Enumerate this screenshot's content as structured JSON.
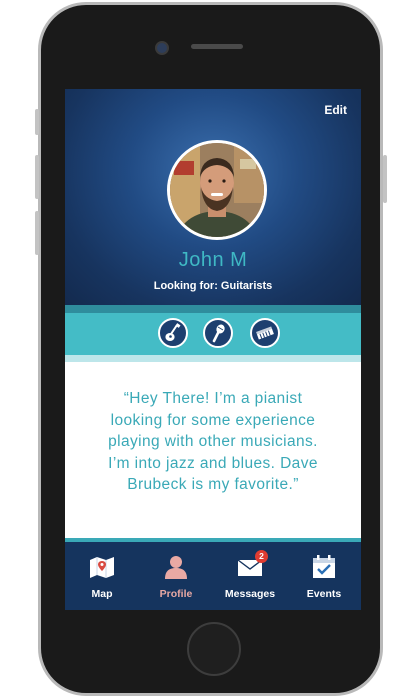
{
  "header": {
    "edit_label": "Edit",
    "name": "John M",
    "looking_for": "Looking for: Guitarists"
  },
  "instruments": [
    {
      "icon": "guitar-icon"
    },
    {
      "icon": "microphone-icon"
    },
    {
      "icon": "keyboard-icon"
    }
  ],
  "bio": {
    "lines": [
      "“Hey There! I’m a pianist",
      "looking for some experience",
      "playing with other musicians.",
      "I’m into jazz and blues. Dave",
      "Brubeck is my favorite.”"
    ]
  },
  "tabbar": {
    "tabs": [
      {
        "label": "Map",
        "icon": "map-icon",
        "active": false
      },
      {
        "label": "Profile",
        "icon": "profile-icon",
        "active": true
      },
      {
        "label": "Messages",
        "icon": "envelope-icon",
        "active": false,
        "badge": "2"
      },
      {
        "label": "Events",
        "icon": "calendar-check-icon",
        "active": false
      }
    ]
  },
  "colors": {
    "header_dark": "#15345e",
    "accent_teal": "#3fb8c4",
    "band_teal": "#44bcc6",
    "active_tab": "#e9a9a4",
    "badge_red": "#e03c31"
  }
}
